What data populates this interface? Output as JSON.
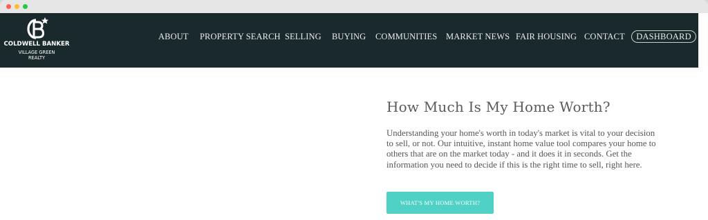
{
  "browser": {
    "controls": [
      "close",
      "minimize",
      "maximize"
    ]
  },
  "header": {
    "logo": {
      "line1": "COLDWELL BANKER",
      "line2": "VILLAGE GREEN",
      "line3": "REALTY",
      "icon": "coldwell-banker-cb-star-logo"
    },
    "nav": {
      "about": "ABOUT",
      "property_search": "PROPERTY SEARCH",
      "selling": "SELLING",
      "buying": "BUYING",
      "communities": "COMMUNITIES",
      "market_news": "MARKET NEWS",
      "fair_housing": "FAIR HOUSING",
      "contact": "CONTACT",
      "dashboard": "DASHBOARD"
    }
  },
  "hero": {
    "title": "How Much Is My Home Worth?",
    "body": "Understanding your home's worth in today's market is vital to your decision to sell, or not. Our intuitive, instant home value tool compares your home to others that are on the market today - and it does it in seconds. Get the information you need to decide if this is the right time to sell, right here.",
    "cta_label": "WHAT'S MY HOME WORTH?"
  },
  "colors": {
    "nav_background": "#1a2a2c",
    "accent": "#4fd1c5",
    "text": "#555555"
  }
}
